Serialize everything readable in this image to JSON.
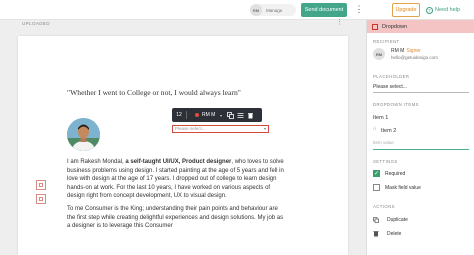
{
  "topbar": {
    "avatar_initials": "RM",
    "manage_label": "Manage",
    "send_label": "Send document",
    "more_icon": "more-vertical-icon",
    "upgrade_label": "Upgrade",
    "help_label": "Need help"
  },
  "document": {
    "header_label": "UPLOADED",
    "quote": "\"Whether I went to College or not, I would always learn\"",
    "paragraph1_intro": "I am Rakesh Mondal, ",
    "paragraph1_bold": "a self-taught UI/UX, Product designer",
    "paragraph1_rest": ", who loves to solve business problems using design. I started painting at the age of 5 years and fell in love with design at the age of 17 years. I dropped out of college to learn design hands-on at work. For the last 10 years, I have worked on various aspects of design right from concept development, UX to visual design.",
    "paragraph2": "To me Consumer is the King; understanding their pain points and behaviour are the first step while creating delightful experiences and design solutions. My job as a designer is to leverage this Consumer"
  },
  "field_toolbar": {
    "font_size": "12",
    "recipient": "RM M",
    "placeholder": "Please select..."
  },
  "panel": {
    "title": "Dropdown",
    "recipient_title": "RECIPIENT",
    "recipient_initials": "RM",
    "recipient_name": "RM M",
    "recipient_role": "Signer",
    "recipient_email": "hello@getuidesign.com",
    "placeholder_title": "PLACEHOLDER",
    "placeholder_value": "Please select...",
    "items_title": "DROPDOWN ITEMS",
    "items": [
      "Item 1",
      "Item 2"
    ],
    "item_value_placeholder": "Item value",
    "settings_title": "SETTINGS",
    "required_label": "Required",
    "mask_label": "Mask field value",
    "actions_title": "ACTIONS",
    "duplicate_label": "Duplicate",
    "delete_label": "Delete"
  },
  "colors": {
    "accent_green": "#43a68a",
    "upgrade_orange": "#e28b1c",
    "field_red": "#d24a3c",
    "panel_header_pink": "#f4c4c4"
  }
}
